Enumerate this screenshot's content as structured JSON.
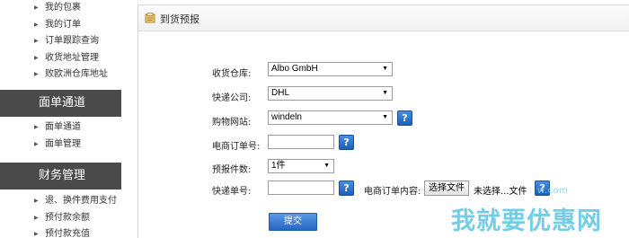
{
  "sidebar": {
    "group1": [
      {
        "label": "我的包裹"
      },
      {
        "label": "我的订单"
      },
      {
        "label": "订单跟踪查询"
      },
      {
        "label": "收货地址管理"
      },
      {
        "label": "败欧洲仓库地址"
      }
    ],
    "header1": "面单通道",
    "group2": [
      {
        "label": "面单通道"
      },
      {
        "label": "面单管理"
      }
    ],
    "header2": "财务管理",
    "group3": [
      {
        "label": "退、换件费用支付"
      },
      {
        "label": "预付款余额"
      },
      {
        "label": "预付款充值"
      }
    ]
  },
  "panel": {
    "title": "到货预报",
    "icon": "document-box-icon"
  },
  "form": {
    "warehouse_label": "收货仓库:",
    "warehouse_value": "Albo GmbH",
    "courier_label": "快递公司:",
    "courier_value": "DHL",
    "shop_label": "购物网站:",
    "shop_value": "windeln",
    "order_no_label": "电商订单号:",
    "order_no_value": "",
    "pieces_label": "预报件数:",
    "pieces_value": "1件",
    "tracking_label": "快递单号:",
    "tracking_value": "",
    "order_content_label": "电商订单内容:",
    "file_button_label": "选择文件",
    "file_status": "未选择...文件",
    "help_glyph": "?",
    "submit_label": "提交"
  },
  "watermark": {
    "url": "w.com",
    "text": "我就要优惠网"
  },
  "colors": {
    "sidebar_header_bg": "#4a4a4a",
    "button_blue": "#2467c4",
    "watermark": "#5cc5e3"
  }
}
